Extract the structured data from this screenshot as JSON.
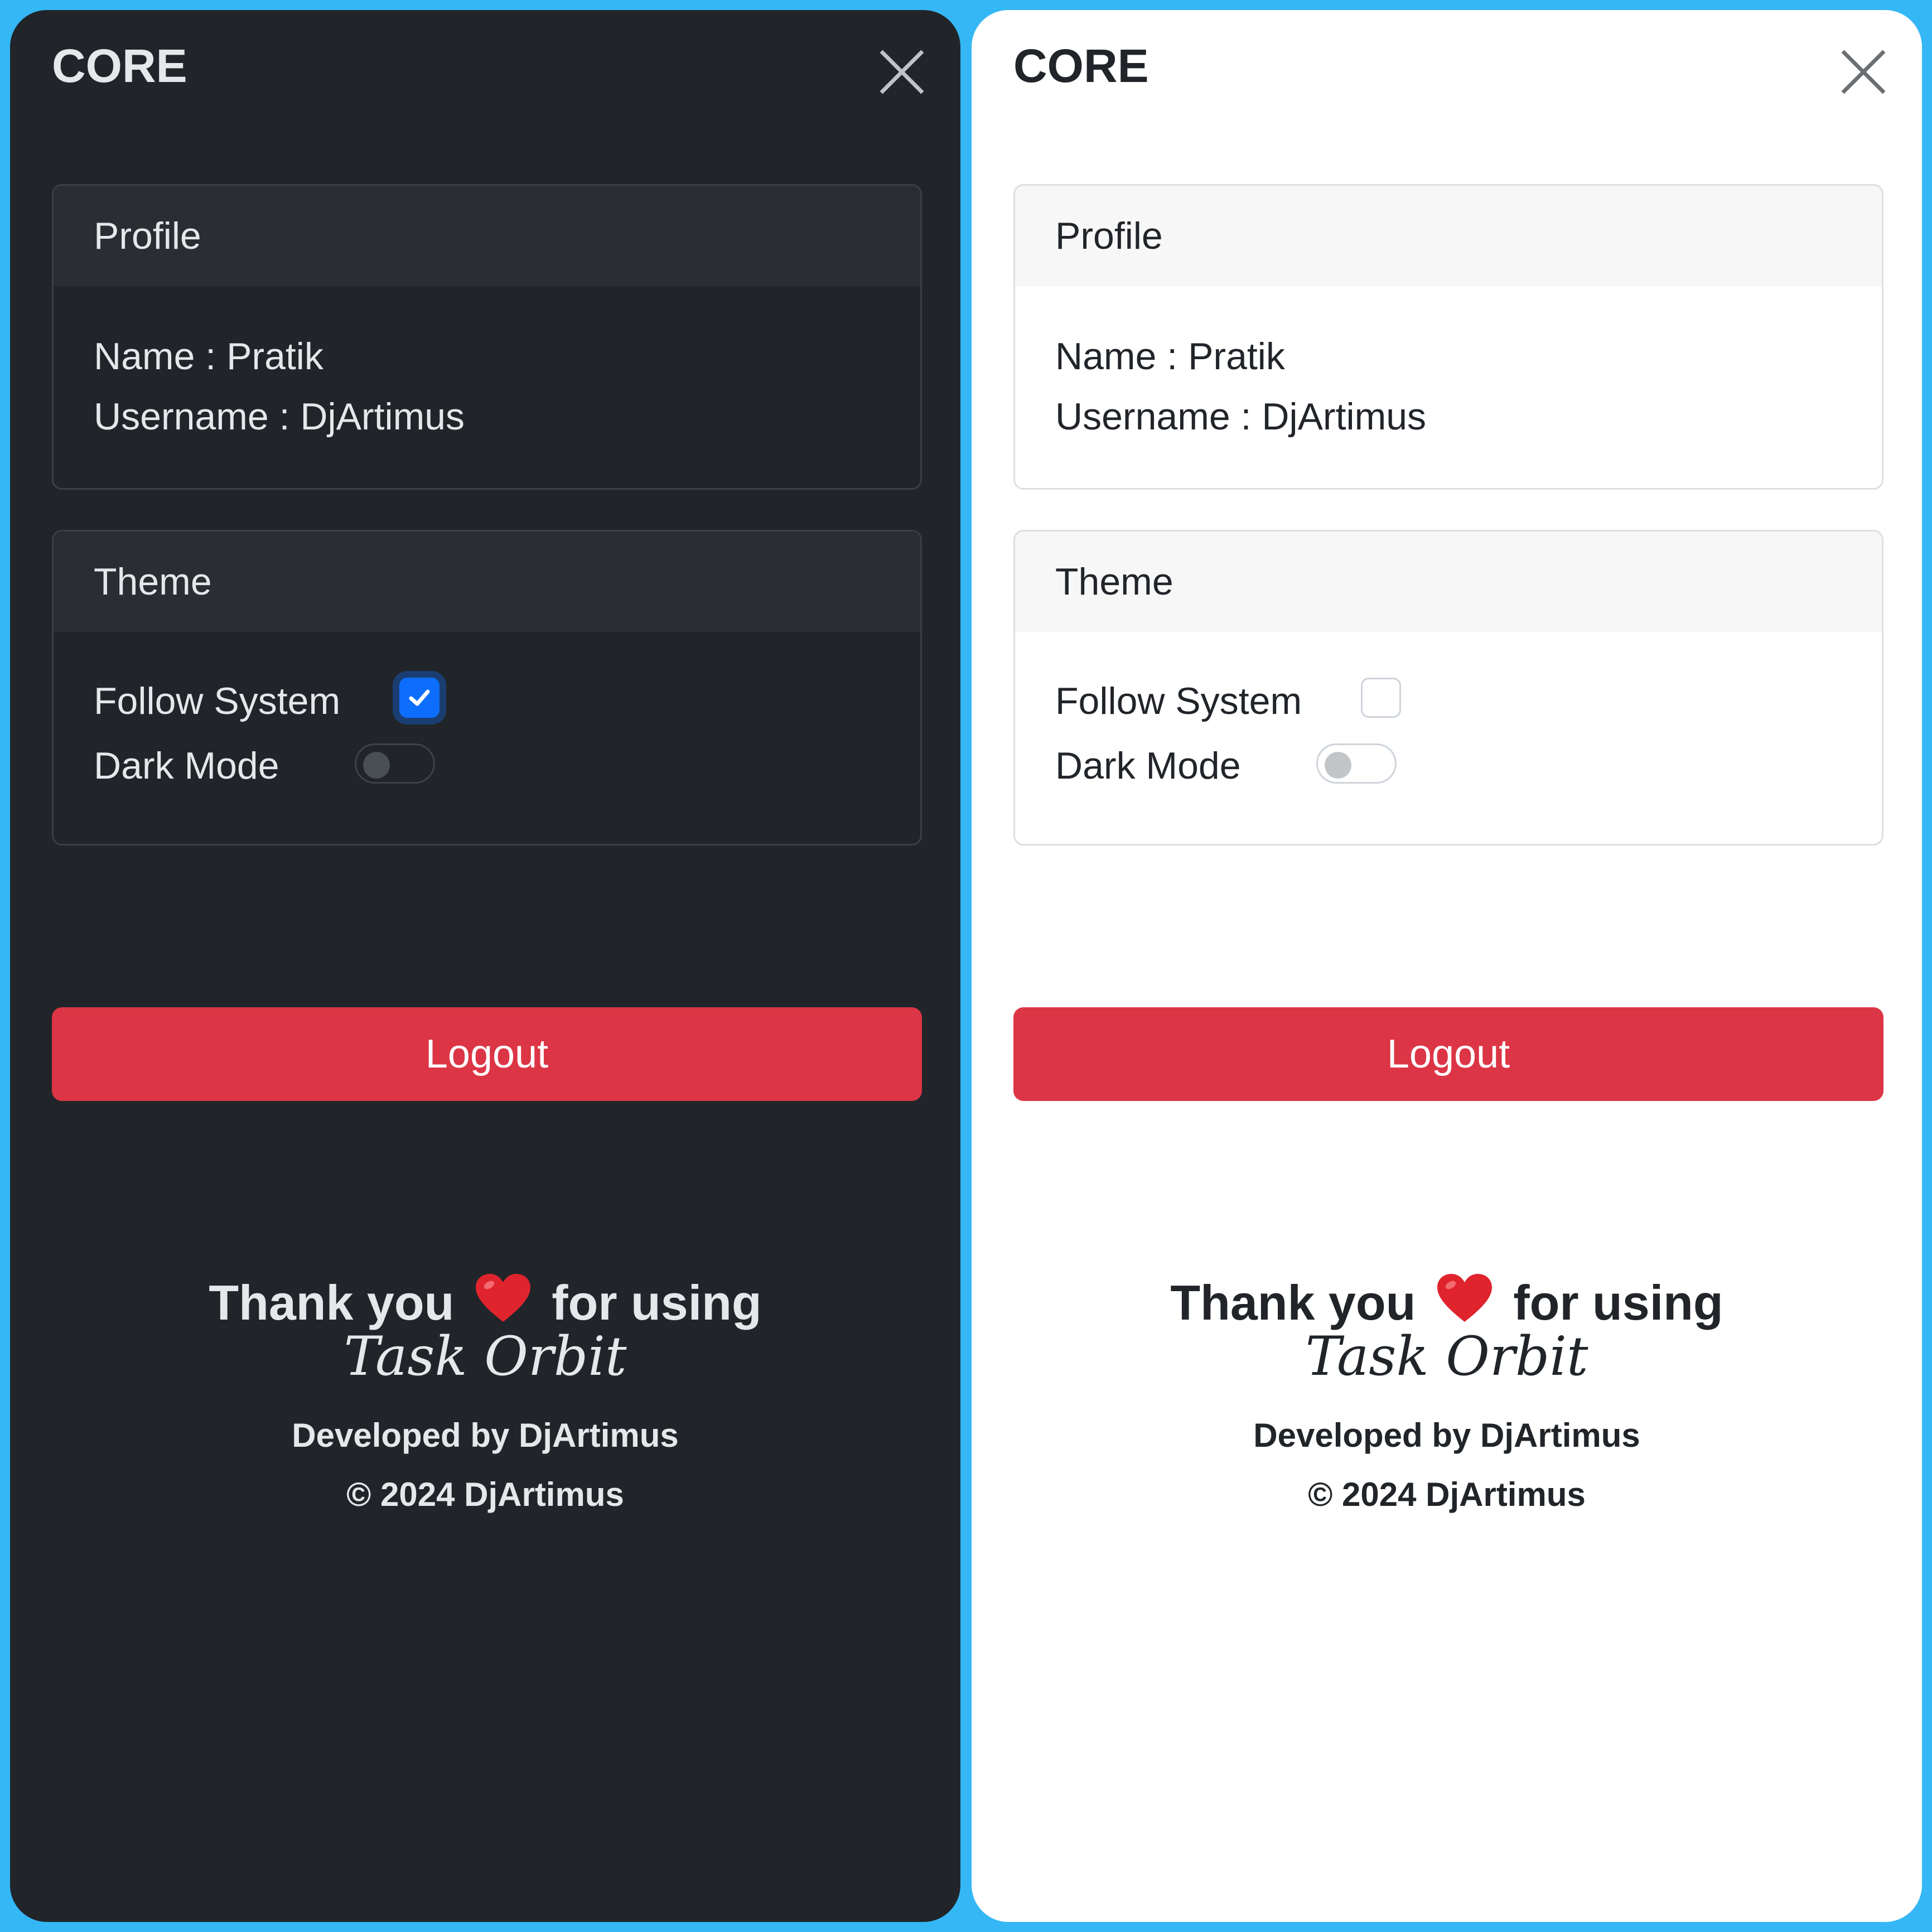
{
  "colors": {
    "background": "#35b7f5",
    "dark_panel": "#212529",
    "light_panel": "#ffffff",
    "logout": "#dc3545",
    "checkbox_checked": "#0d6efd",
    "heart": "#e0242e"
  },
  "panels": [
    {
      "theme": "dark",
      "title": "CORE",
      "close_icon": "close-icon",
      "profile": {
        "header": "Profile",
        "name": "Name : Pratik",
        "username": "Username : DjArtimus"
      },
      "theme_settings": {
        "header": "Theme",
        "follow_system_label": "Follow System",
        "follow_system_checked": true,
        "dark_mode_label": "Dark Mode",
        "dark_mode_on": false
      },
      "logout_label": "Logout",
      "footer": {
        "thanks_before": "Thank you",
        "heart_icon": "heart-icon",
        "thanks_after": "for using",
        "app_name": "Task Orbit",
        "developed_by": "Developed by DjArtimus",
        "copyright": "© 2024 DjArtimus"
      }
    },
    {
      "theme": "light",
      "title": "CORE",
      "close_icon": "close-icon",
      "profile": {
        "header": "Profile",
        "name": "Name : Pratik",
        "username": "Username : DjArtimus"
      },
      "theme_settings": {
        "header": "Theme",
        "follow_system_label": "Follow System",
        "follow_system_checked": false,
        "dark_mode_label": "Dark Mode",
        "dark_mode_on": false
      },
      "logout_label": "Logout",
      "footer": {
        "thanks_before": "Thank you",
        "heart_icon": "heart-icon",
        "thanks_after": "for using",
        "app_name": "Task Orbit",
        "developed_by": "Developed by DjArtimus",
        "copyright": "© 2024 DjArtimus"
      }
    }
  ]
}
